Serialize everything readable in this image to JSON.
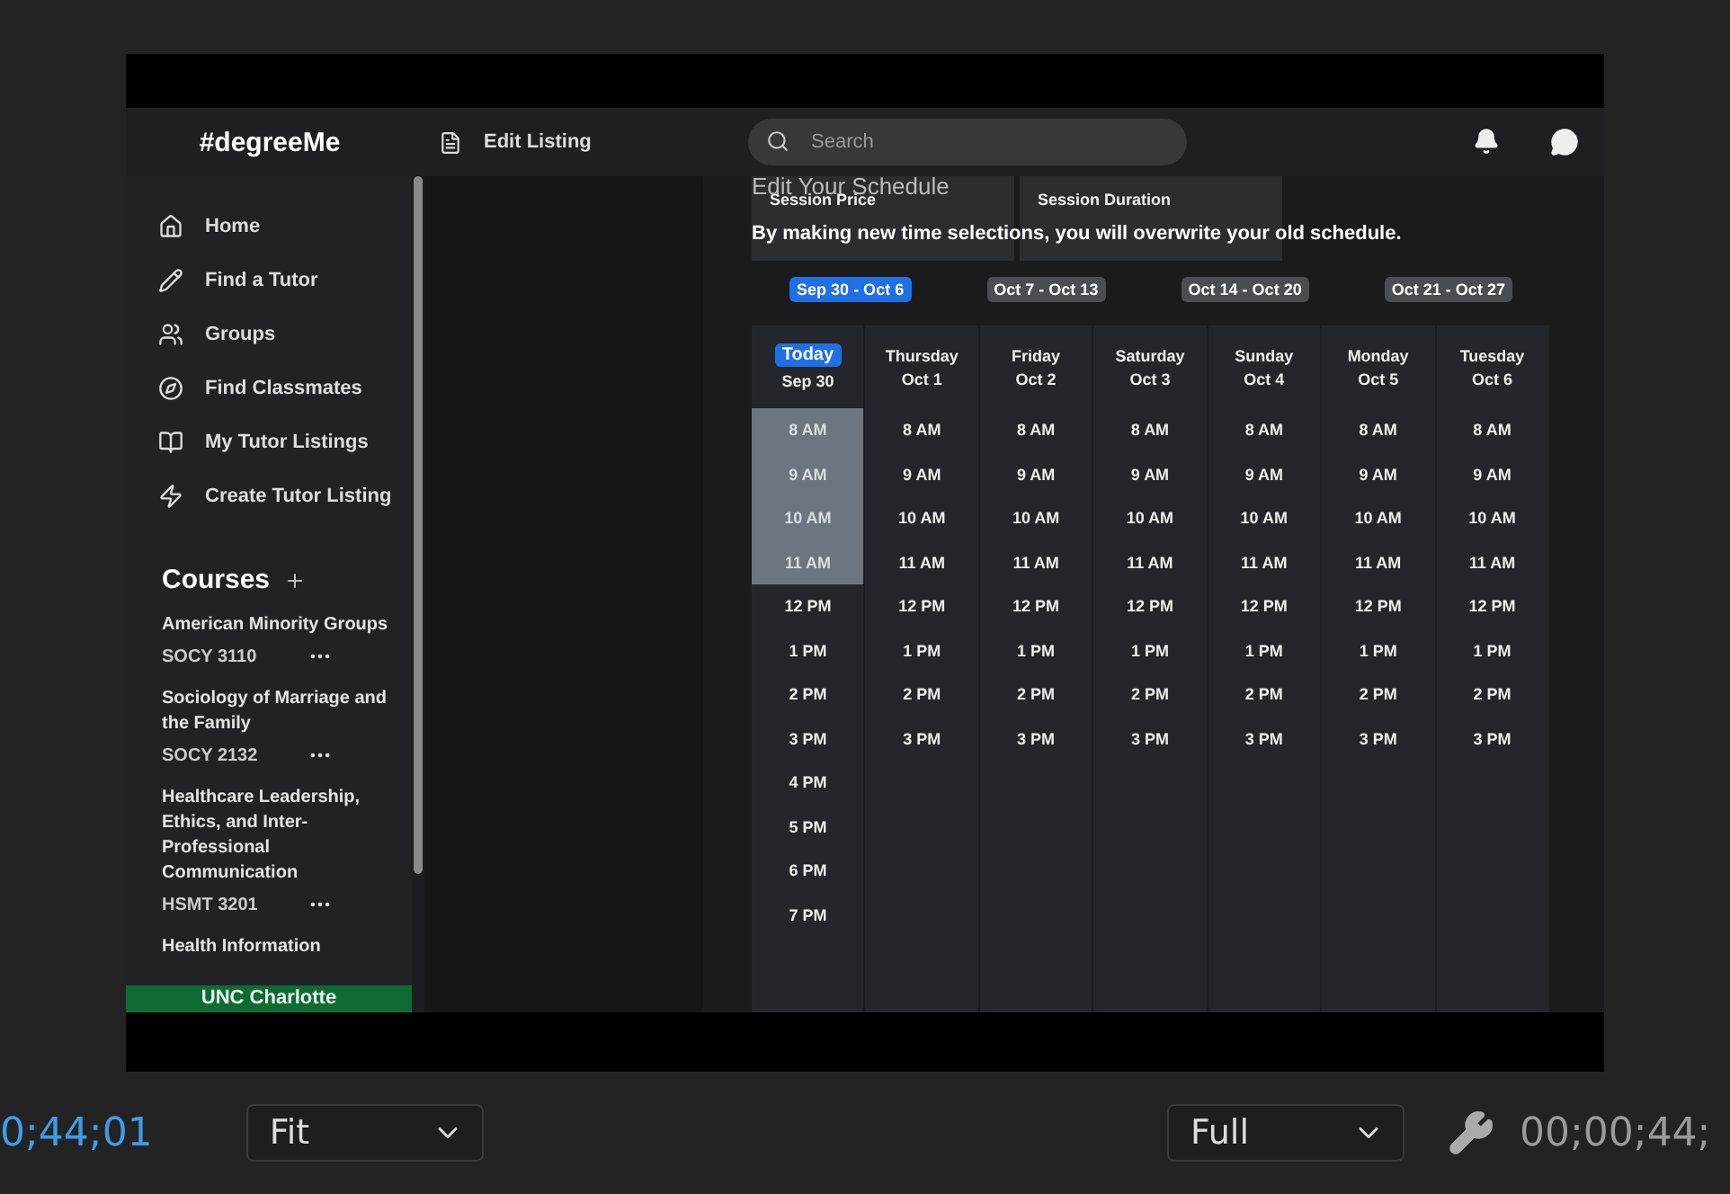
{
  "app": {
    "logo": "#degreeMe",
    "page_title": "Edit Listing",
    "search": {
      "placeholder": "Search"
    },
    "nav": [
      {
        "kind": "home",
        "label": "Home"
      },
      {
        "kind": "pencil",
        "label": "Find a Tutor"
      },
      {
        "kind": "users",
        "label": "Groups"
      },
      {
        "kind": "compass",
        "label": "Find Classmates"
      },
      {
        "kind": "book",
        "label": "My Tutor Listings"
      },
      {
        "kind": "bolt",
        "label": "Create Tutor Listing"
      }
    ],
    "courses_title": "Courses",
    "courses": [
      {
        "name": "American Minority Groups",
        "code": "SOCY 3110"
      },
      {
        "name": "Sociology of Marriage and the Family",
        "code": "SOCY 2132"
      },
      {
        "name": "Healthcare Leadership, Ethics, and Inter-Professional Communication",
        "code": "HSMT 3201"
      },
      {
        "name": "Health Information"
      }
    ],
    "school": "UNC Charlotte",
    "schedule": {
      "title": "Edit Your Schedule",
      "cards": [
        "Session Price",
        "Session Duration"
      ],
      "notice": "By making new time selections, you will overwrite your old schedule.",
      "weeks": [
        {
          "label": "Sep 30 - Oct 6",
          "selected": true
        },
        {
          "label": "Oct 7 - Oct 13",
          "selected": false
        },
        {
          "label": "Oct 14 - Oct 20",
          "selected": false
        },
        {
          "label": "Oct 21 - Oct 27",
          "selected": false
        }
      ],
      "days": [
        {
          "day": "Sep 30",
          "today_label": "Today",
          "slots": [
            {
              "time": "8 AM",
              "selected": true
            },
            {
              "time": "9 AM",
              "selected": true
            },
            {
              "time": "10 AM",
              "selected": true
            },
            {
              "time": "11 AM",
              "selected": true
            },
            {
              "time": "12 PM",
              "selected": false
            },
            {
              "time": "1 PM",
              "selected": false
            },
            {
              "time": "2 PM",
              "selected": false
            },
            {
              "time": "3 PM",
              "selected": false
            },
            {
              "time": "4 PM",
              "selected": false
            },
            {
              "time": "5 PM",
              "selected": false
            },
            {
              "time": "6 PM",
              "selected": false
            },
            {
              "time": "7 PM",
              "selected": false
            }
          ]
        },
        {
          "day": "Thursday",
          "date": "Oct 1",
          "slots": [
            {
              "time": "8 AM",
              "selected": false
            },
            {
              "time": "9 AM",
              "selected": false
            },
            {
              "time": "10 AM",
              "selected": false
            },
            {
              "time": "11 AM",
              "selected": false
            },
            {
              "time": "12 PM",
              "selected": false
            },
            {
              "time": "1 PM",
              "selected": false
            },
            {
              "time": "2 PM",
              "selected": false
            },
            {
              "time": "3 PM",
              "selected": false
            }
          ]
        },
        {
          "day": "Friday",
          "date": "Oct 2",
          "slots": [
            {
              "time": "8 AM",
              "selected": false
            },
            {
              "time": "9 AM",
              "selected": false
            },
            {
              "time": "10 AM",
              "selected": false
            },
            {
              "time": "11 AM",
              "selected": false
            },
            {
              "time": "12 PM",
              "selected": false
            },
            {
              "time": "1 PM",
              "selected": false
            },
            {
              "time": "2 PM",
              "selected": false
            },
            {
              "time": "3 PM",
              "selected": false
            }
          ]
        },
        {
          "day": "Saturday",
          "date": "Oct 3",
          "slots": [
            {
              "time": "8 AM",
              "selected": false
            },
            {
              "time": "9 AM",
              "selected": false
            },
            {
              "time": "10 AM",
              "selected": false
            },
            {
              "time": "11 AM",
              "selected": false
            },
            {
              "time": "12 PM",
              "selected": false
            },
            {
              "time": "1 PM",
              "selected": false
            },
            {
              "time": "2 PM",
              "selected": false
            },
            {
              "time": "3 PM",
              "selected": false
            }
          ]
        },
        {
          "day": "Sunday",
          "date": "Oct 4",
          "slots": [
            {
              "time": "8 AM",
              "selected": false
            },
            {
              "time": "9 AM",
              "selected": false
            },
            {
              "time": "10 AM",
              "selected": false
            },
            {
              "time": "11 AM",
              "selected": false
            },
            {
              "time": "12 PM",
              "selected": false
            },
            {
              "time": "1 PM",
              "selected": false
            },
            {
              "time": "2 PM",
              "selected": false
            },
            {
              "time": "3 PM",
              "selected": false
            }
          ]
        },
        {
          "day": "Monday",
          "date": "Oct 5",
          "slots": [
            {
              "time": "8 AM",
              "selected": false
            },
            {
              "time": "9 AM",
              "selected": false
            },
            {
              "time": "10 AM",
              "selected": false
            },
            {
              "time": "11 AM",
              "selected": false
            },
            {
              "time": "12 PM",
              "selected": false
            },
            {
              "time": "1 PM",
              "selected": false
            },
            {
              "time": "2 PM",
              "selected": false
            },
            {
              "time": "3 PM",
              "selected": false
            }
          ]
        },
        {
          "day": "Tuesday",
          "date": "Oct 6",
          "slots": [
            {
              "time": "8 AM",
              "selected": false
            },
            {
              "time": "9 AM",
              "selected": false
            },
            {
              "time": "10 AM",
              "selected": false
            },
            {
              "time": "11 AM",
              "selected": false
            },
            {
              "time": "12 PM",
              "selected": false
            },
            {
              "time": "1 PM",
              "selected": false
            },
            {
              "time": "2 PM",
              "selected": false
            },
            {
              "time": "3 PM",
              "selected": false
            }
          ]
        }
      ]
    }
  },
  "player": {
    "current_time": "0;44;01",
    "zoom": "Fit",
    "quality": "Full",
    "duration": "00;00;44;"
  }
}
